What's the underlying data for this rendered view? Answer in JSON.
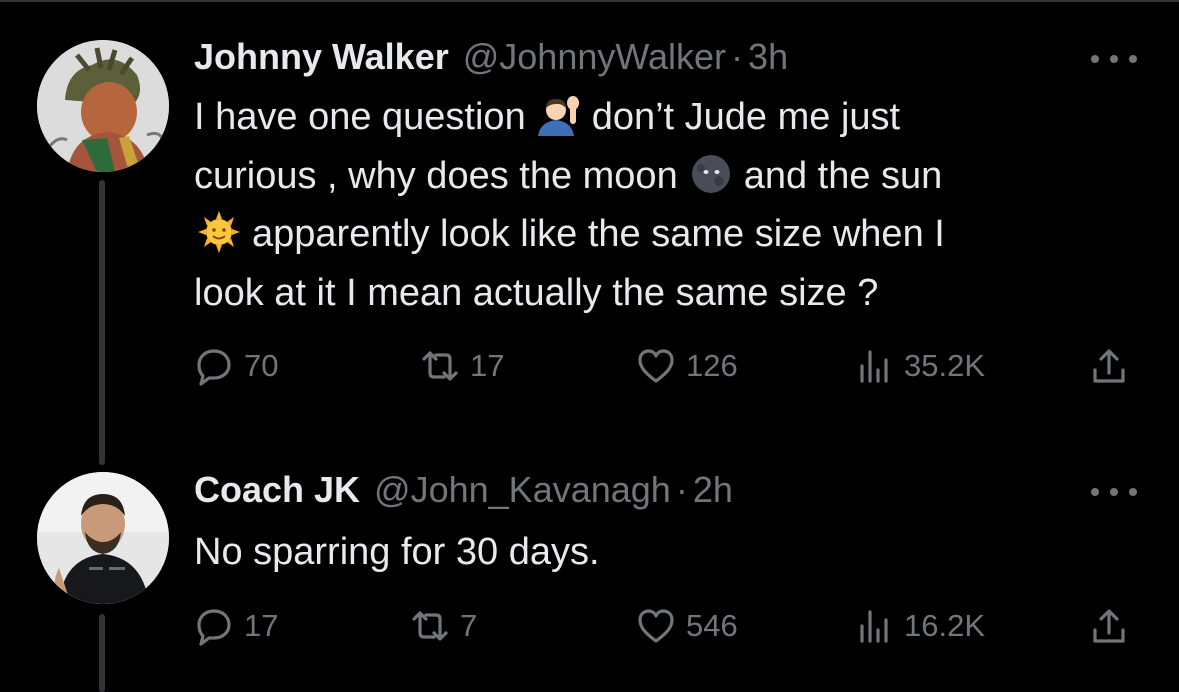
{
  "tweets": [
    {
      "name": "Johnny  Walker",
      "handle": "@JohnnyWalker",
      "dot": "·",
      "time": "3h",
      "lines": [
        {
          "parts": [
            "I have one question",
            "don’t Jude me just"
          ],
          "emoji": "person-raising-hand-emoji"
        },
        {
          "parts": [
            "curious , why does the moon",
            "and the sun"
          ],
          "emoji": "new-moon-face-emoji"
        },
        {
          "parts": [
            "",
            "apparently look like the same size when I"
          ],
          "emoji": "sun-with-face-emoji"
        },
        {
          "parts": [
            "look at it  I mean actually the same size ?"
          ]
        }
      ],
      "stats": {
        "replies": "70",
        "reposts": "17",
        "likes": "126",
        "views": "35.2K"
      }
    },
    {
      "name": "Coach JK",
      "handle": "@John_Kavanagh",
      "dot": "·",
      "time": "2h",
      "lines": [
        {
          "parts": [
            "No sparring for 30 days."
          ]
        }
      ],
      "stats": {
        "replies": "17",
        "reposts": "7",
        "likes": "546",
        "views": "16.2K"
      }
    }
  ],
  "icons": [
    "more-icon",
    "reply-icon",
    "repost-icon",
    "like-icon",
    "views-icon",
    "share-icon"
  ],
  "colors": {
    "background": "#000000",
    "text": "#e7e9ea",
    "secondary": "#71767b",
    "thread_line": "#333639"
  }
}
